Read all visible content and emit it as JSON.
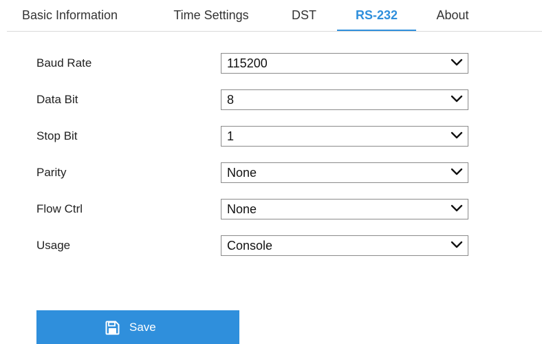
{
  "tabs": [
    {
      "label": "Basic Information",
      "active": false
    },
    {
      "label": "Time Settings",
      "active": false
    },
    {
      "label": "DST",
      "active": false
    },
    {
      "label": "RS-232",
      "active": true
    },
    {
      "label": "About",
      "active": false
    }
  ],
  "form": {
    "fields": [
      {
        "label": "Baud Rate",
        "value": "115200"
      },
      {
        "label": "Data Bit",
        "value": "8"
      },
      {
        "label": "Stop Bit",
        "value": "1"
      },
      {
        "label": "Parity",
        "value": "None"
      },
      {
        "label": "Flow Ctrl",
        "value": "None"
      },
      {
        "label": "Usage",
        "value": "Console"
      }
    ],
    "dropdown_icon": "chevron-down-icon"
  },
  "save_button": {
    "label": "Save",
    "icon": "floppy-disk-icon"
  },
  "colors": {
    "accent": "#2f8fdc",
    "text": "#222222",
    "border": "#8a8a8a",
    "divider": "#d9d9d9"
  }
}
